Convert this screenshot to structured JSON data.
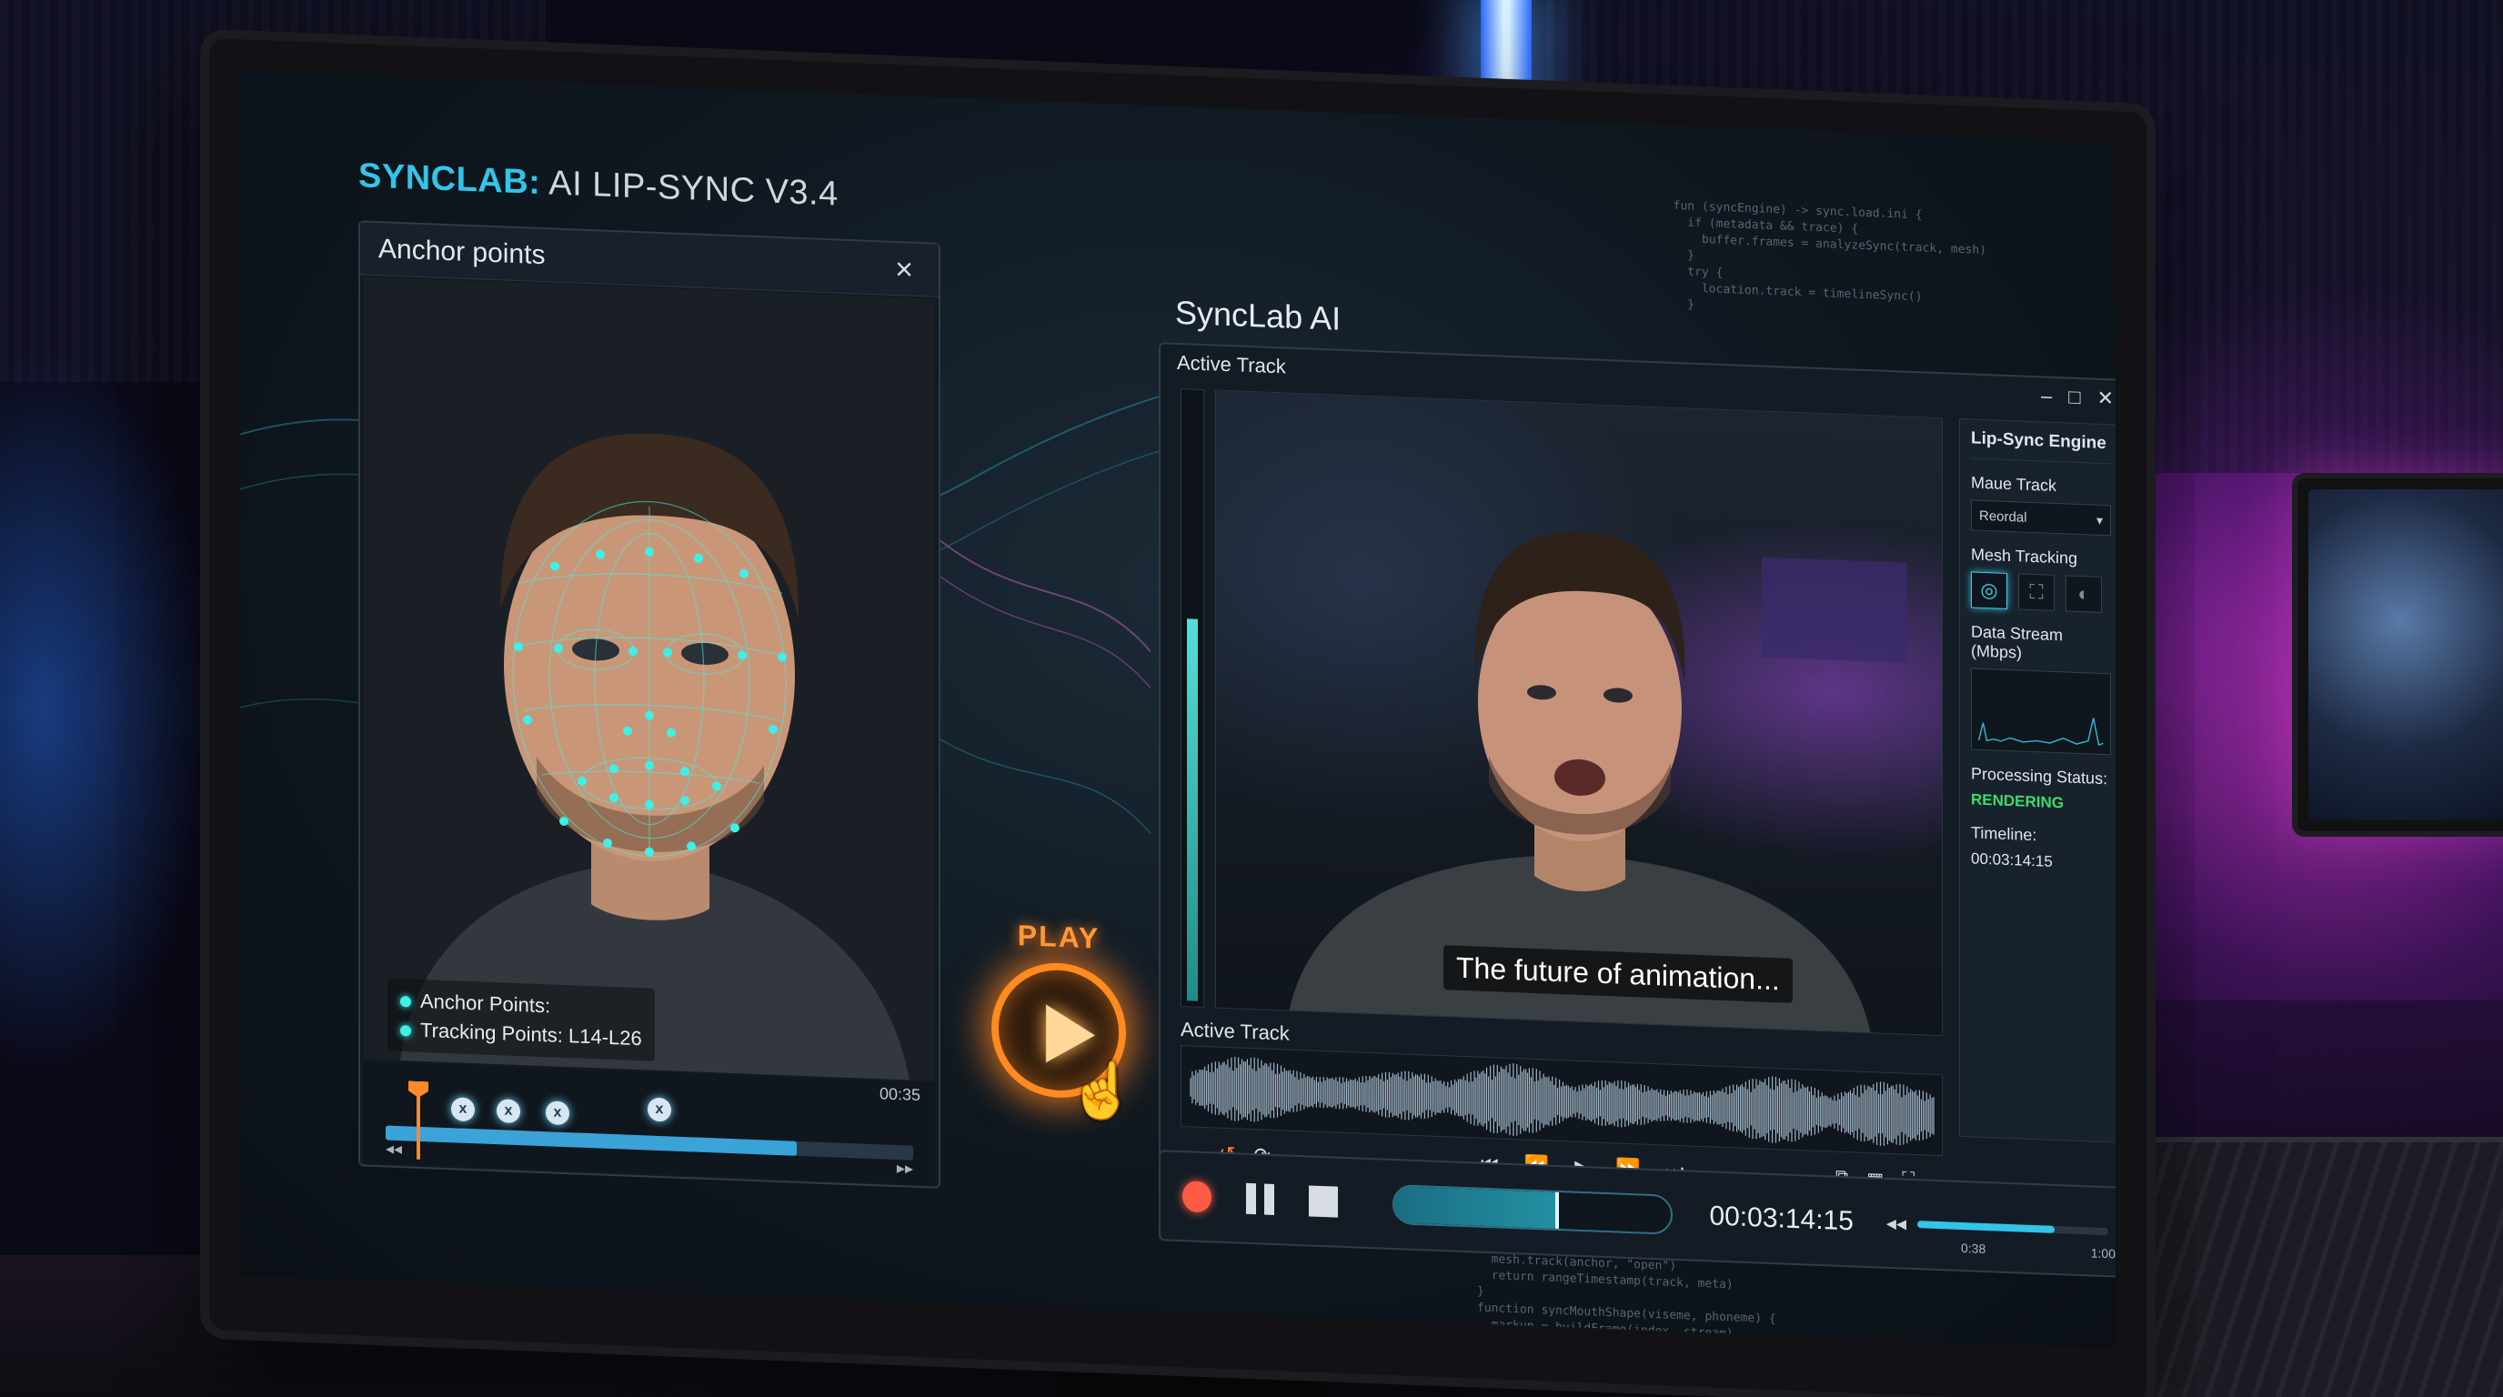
{
  "app": {
    "brand": "SYNCLAB:",
    "title_rest": " AI LIP-SYNC V3.4"
  },
  "anchor_panel": {
    "title": "Anchor points",
    "legend": {
      "anchor_points": "Anchor Points:",
      "tracking_points": "Tracking Points: L14-L26"
    },
    "time": "00:35",
    "pin_glyph": "x"
  },
  "play": {
    "label": "PLAY"
  },
  "sync_window": {
    "title": "SyncLab AI",
    "active_track_label": "Active Track",
    "subtitle": "The future of animation...",
    "audio_label": "Active Track",
    "level_fraction": 0.62,
    "side_panel": {
      "heading": "Lip-Sync Engine",
      "maue_track_label": "Maue Track",
      "maue_track_value": "Reordal",
      "mesh_tracking_label": "Mesh Tracking",
      "data_stream_label": "Data Stream (Mbps)",
      "processing_label": "Processing Status:",
      "processing_value": "RENDERING",
      "timeline_label": "Timeline:",
      "timeline_value": "00:03:14:15"
    }
  },
  "transport": {
    "timecode": "00:03:14:15",
    "progress_fraction": 0.58,
    "volume_fraction": 0.72,
    "vol_label_1": "0:38",
    "vol_label_2": "1:00"
  },
  "anchor_timeline": {
    "progress_fraction": 0.78
  },
  "colors": {
    "accent": "#33c4e8",
    "play": "#ff8a1f",
    "status_ok": "#3ddc6a",
    "record": "#ff5a44"
  },
  "icons": [
    "close-icon",
    "minimize-icon",
    "maximize-icon",
    "play-icon",
    "pause-icon",
    "stop-icon",
    "record-icon",
    "skip-back-icon",
    "rewind-icon",
    "fast-forward-icon",
    "skip-forward-icon",
    "loop-icon",
    "volume-icon",
    "hand-cursor-icon"
  ]
}
